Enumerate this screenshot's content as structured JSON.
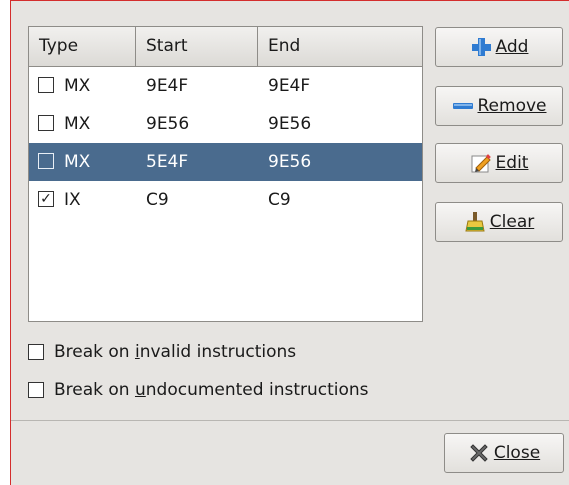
{
  "table": {
    "headers": [
      "Type",
      "Start",
      "End"
    ],
    "rows": [
      {
        "checked": false,
        "type": "MX",
        "start": "9E4F",
        "end": "9E4F",
        "selected": false
      },
      {
        "checked": false,
        "type": "MX",
        "start": "9E56",
        "end": "9E56",
        "selected": false
      },
      {
        "checked": false,
        "type": "MX",
        "start": "5E4F",
        "end": "9E56",
        "selected": true
      },
      {
        "checked": true,
        "type": "IX",
        "start": "C9",
        "end": "C9",
        "selected": false
      }
    ]
  },
  "buttons": {
    "add": "Add",
    "remove": "Remove",
    "edit": "Edit",
    "clear": "Clear",
    "close": "Close"
  },
  "options": {
    "break_invalid_pre": "Break on ",
    "break_invalid_u": "i",
    "break_invalid_post": "nvalid instructions",
    "break_undoc_pre": "Break on ",
    "break_undoc_u": "u",
    "break_undoc_post": "ndocumented instructions"
  },
  "colors": {
    "selection": "#4a6b8e",
    "dialog_bg": "#e6e4e1"
  },
  "icons": {
    "add": "plus-icon",
    "remove": "minus-icon",
    "edit": "pencil-icon",
    "clear": "broom-icon",
    "close": "x-icon"
  }
}
